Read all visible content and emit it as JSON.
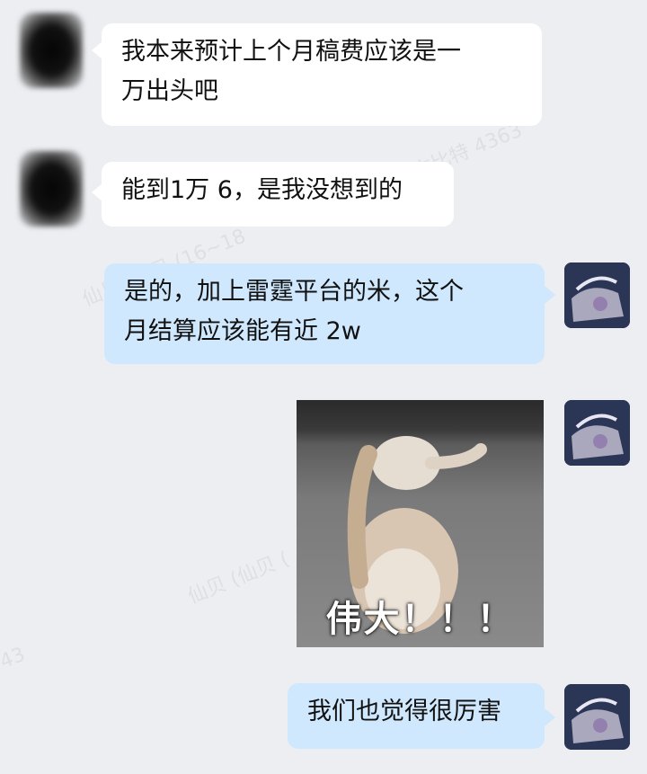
{
  "watermarks": [
    "古比特 4363",
    "仙贝 (仙贝 (16~18",
    "仙贝 (仙贝 (",
    "仙贝 (仙贝 (16~18",
    "43"
  ],
  "messages": [
    {
      "side": "left",
      "avatar_icon": "blurred-contact-avatar",
      "text_lines": [
        "我本来预计上个月稿费应该是一",
        "万出头吧"
      ]
    },
    {
      "side": "left",
      "avatar_icon": "blurred-contact-avatar",
      "text_lines": [
        "能到1万 6，是我没想到的"
      ]
    },
    {
      "side": "right",
      "avatar_icon": "anime-user-avatar",
      "text_lines": [
        "是的，加上雷霆平台的米，这个",
        "月结算应该能有近 2w"
      ]
    },
    {
      "side": "right",
      "avatar_icon": "anime-user-avatar",
      "sticker": {
        "icon": "hamster-sticker",
        "caption": "伟大！！！"
      }
    },
    {
      "side": "right",
      "avatar_icon": "anime-user-avatar",
      "text_lines": [
        "我们也觉得很厉害"
      ]
    }
  ],
  "colors": {
    "background": "#eceef2",
    "incoming_bubble": "#ffffff",
    "outgoing_bubble": "#cfe8fd"
  }
}
